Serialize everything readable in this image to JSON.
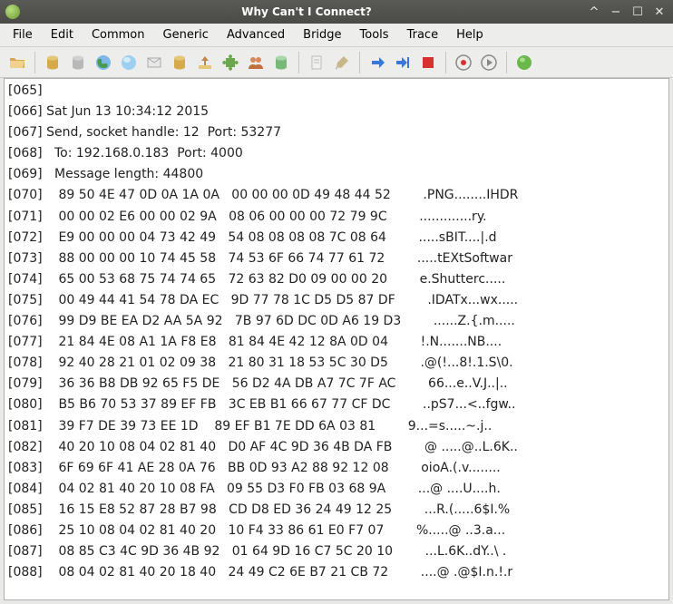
{
  "window": {
    "title": "Why Can't I Connect?"
  },
  "menu": {
    "file": "File",
    "edit": "Edit",
    "common": "Common",
    "generic": "Generic",
    "advanced": "Advanced",
    "bridge": "Bridge",
    "tools": "Tools",
    "trace": "Trace",
    "help": "Help"
  },
  "log_lines": [
    "[065]",
    "[066] Sat Jun 13 10:34:12 2015",
    "[067] Send, socket handle: 12  Port: 53277",
    "[068]   To: 192.168.0.183  Port: 4000",
    "[069]   Message length: 44800",
    "[070]    89 50 4E 47 0D 0A 1A 0A   00 00 00 0D 49 48 44 52        .PNG........IHDR",
    "[071]    00 00 02 E6 00 00 02 9A   08 06 00 00 00 72 79 9C        .............ry.",
    "[072]    E9 00 00 00 04 73 42 49   54 08 08 08 08 7C 08 64        .....sBIT....|.d",
    "[073]    88 00 00 00 10 74 45 58   74 53 6F 66 74 77 61 72        .....tEXtSoftwar",
    "[074]    65 00 53 68 75 74 74 65   72 63 82 D0 09 00 00 20        e.Shutterc..... ",
    "[075]    00 49 44 41 54 78 DA EC   9D 77 78 1C D5 D5 87 DF        .IDATx...wx.....",
    "[076]    99 D9 BE EA D2 AA 5A 92   7B 97 6D DC 0D A6 19 D3        ......Z.{.m.....",
    "[077]    21 84 4E 08 A1 1A F8 E8   81 84 4E 42 12 8A 0D 04        !.N.......NB....",
    "[078]    92 40 28 21 01 02 09 38   21 80 31 18 53 5C 30 D5        .@(!...8!.1.S\\0.",
    "[079]    36 36 B8 DB 92 65 F5 DE   56 D2 4A DB A7 7C 7F AC        66...e..V.J..|..",
    "[080]    B5 B6 70 53 37 89 EF FB   3C EB B1 66 67 77 CF DC        ..pS7...<..fgw..",
    "[081]    39 F7 DE 39 73 EE 1D    89 EF B1 7E DD 6A 03 81        9...=s.....~.j..",
    "[082]    40 20 10 08 04 02 81 40   D0 AF 4C 9D 36 4B DA FB        @ .....@..L.6K..",
    "[083]    6F 69 6F 41 AE 28 0A 76   BB 0D 93 A2 88 92 12 08        oioA.(.v........",
    "[084]    04 02 81 40 20 10 08 FA   09 55 D3 F0 FB 03 68 9A        ...@ ....U....h.",
    "[085]    16 15 E8 52 87 28 B7 98   CD D8 ED 36 24 49 12 25        ...R.(.....6$I.%",
    "[086]    25 10 08 04 02 81 40 20   10 F4 33 86 61 E0 F7 07        %.....@ ..3.a...",
    "[087]    08 85 C3 4C 9D 36 4B 92   01 64 9D 16 C7 5C 20 10        ...L.6K..dY..\\ .",
    "[088]    08 04 02 81 40 20 18 40   24 49 C2 6E B7 21 CB 72        ....@ .@$I.n.!.r"
  ]
}
